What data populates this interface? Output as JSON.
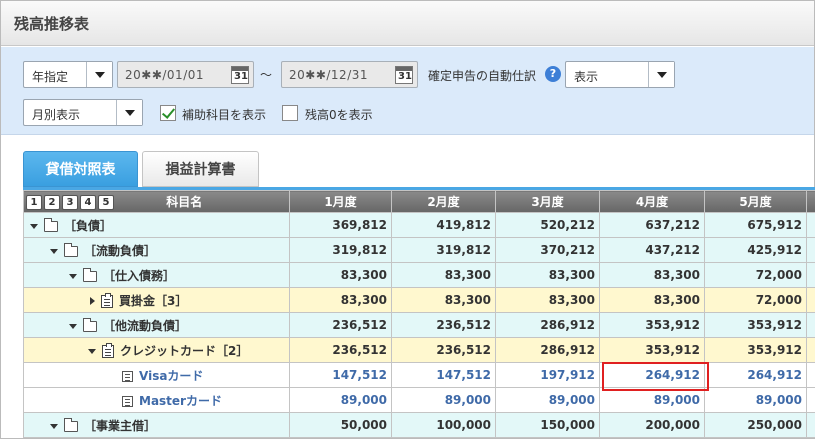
{
  "page": {
    "title": "残高推移表"
  },
  "filters": {
    "period_type": "年指定",
    "date_from": "20✱✱/01/01",
    "date_to": "20✱✱/12/31",
    "calendar_glyph": "31",
    "range_sep": "～",
    "auto_journal_label": "確定申告の自動仕訳",
    "help_glyph": "?",
    "auto_journal_value": "表示",
    "display_mode": "月別表示",
    "show_sub_label": "補助科目を表示",
    "show_sub_checked": true,
    "show_zero_label": "残高0を表示",
    "show_zero_checked": false
  },
  "tabs": [
    {
      "label": "貸借対照表",
      "active": true
    },
    {
      "label": "損益計算書",
      "active": false
    }
  ],
  "table": {
    "level_buttons": [
      "1",
      "2",
      "3",
      "4",
      "5"
    ],
    "headers": [
      "科目名",
      "1月度",
      "2月度",
      "3月度",
      "4月度",
      "5月度"
    ],
    "rows": [
      {
        "name": "［負債］",
        "values": [
          "369,812",
          "419,812",
          "520,212",
          "637,212",
          "675,912"
        ]
      },
      {
        "name": "［流動負債］",
        "values": [
          "319,812",
          "319,812",
          "370,212",
          "437,212",
          "425,912"
        ]
      },
      {
        "name": "［仕入債務］",
        "values": [
          "83,300",
          "83,300",
          "83,300",
          "83,300",
          "72,000"
        ]
      },
      {
        "name": "買掛金［3］",
        "values": [
          "83,300",
          "83,300",
          "83,300",
          "83,300",
          "72,000"
        ]
      },
      {
        "name": "［他流動負債］",
        "values": [
          "236,512",
          "236,512",
          "286,912",
          "353,912",
          "353,912"
        ]
      },
      {
        "name": "クレジットカード［2］",
        "values": [
          "236,512",
          "236,512",
          "286,912",
          "353,912",
          "353,912"
        ]
      },
      {
        "name": "Visaカード",
        "values": [
          "147,512",
          "147,512",
          "197,912",
          "264,912",
          "264,912"
        ]
      },
      {
        "name": "Masterカード",
        "values": [
          "89,000",
          "89,000",
          "89,000",
          "89,000",
          "89,000"
        ]
      },
      {
        "name": "［事業主借］",
        "values": [
          "50,000",
          "100,000",
          "150,000",
          "200,000",
          "250,000"
        ]
      }
    ]
  },
  "colors": {
    "tab_active": "#3a9fe0",
    "filter_bg": "#dbeafa",
    "row_cyan": "#e3f8f8",
    "row_yellow": "#fff8cf",
    "highlight": "#e02020"
  }
}
